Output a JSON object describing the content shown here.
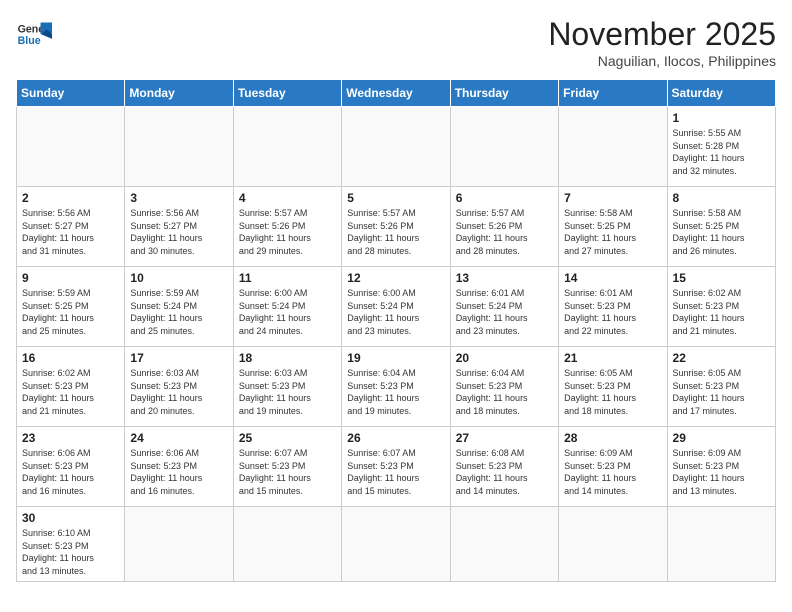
{
  "header": {
    "logo_general": "General",
    "logo_blue": "Blue",
    "title": "November 2025",
    "subtitle": "Naguilian, Ilocos, Philippines"
  },
  "weekdays": [
    "Sunday",
    "Monday",
    "Tuesday",
    "Wednesday",
    "Thursday",
    "Friday",
    "Saturday"
  ],
  "weeks": [
    [
      {
        "day": "",
        "info": ""
      },
      {
        "day": "",
        "info": ""
      },
      {
        "day": "",
        "info": ""
      },
      {
        "day": "",
        "info": ""
      },
      {
        "day": "",
        "info": ""
      },
      {
        "day": "",
        "info": ""
      },
      {
        "day": "1",
        "info": "Sunrise: 5:55 AM\nSunset: 5:28 PM\nDaylight: 11 hours\nand 32 minutes."
      }
    ],
    [
      {
        "day": "2",
        "info": "Sunrise: 5:56 AM\nSunset: 5:27 PM\nDaylight: 11 hours\nand 31 minutes."
      },
      {
        "day": "3",
        "info": "Sunrise: 5:56 AM\nSunset: 5:27 PM\nDaylight: 11 hours\nand 30 minutes."
      },
      {
        "day": "4",
        "info": "Sunrise: 5:57 AM\nSunset: 5:26 PM\nDaylight: 11 hours\nand 29 minutes."
      },
      {
        "day": "5",
        "info": "Sunrise: 5:57 AM\nSunset: 5:26 PM\nDaylight: 11 hours\nand 28 minutes."
      },
      {
        "day": "6",
        "info": "Sunrise: 5:57 AM\nSunset: 5:26 PM\nDaylight: 11 hours\nand 28 minutes."
      },
      {
        "day": "7",
        "info": "Sunrise: 5:58 AM\nSunset: 5:25 PM\nDaylight: 11 hours\nand 27 minutes."
      },
      {
        "day": "8",
        "info": "Sunrise: 5:58 AM\nSunset: 5:25 PM\nDaylight: 11 hours\nand 26 minutes."
      }
    ],
    [
      {
        "day": "9",
        "info": "Sunrise: 5:59 AM\nSunset: 5:25 PM\nDaylight: 11 hours\nand 25 minutes."
      },
      {
        "day": "10",
        "info": "Sunrise: 5:59 AM\nSunset: 5:24 PM\nDaylight: 11 hours\nand 25 minutes."
      },
      {
        "day": "11",
        "info": "Sunrise: 6:00 AM\nSunset: 5:24 PM\nDaylight: 11 hours\nand 24 minutes."
      },
      {
        "day": "12",
        "info": "Sunrise: 6:00 AM\nSunset: 5:24 PM\nDaylight: 11 hours\nand 23 minutes."
      },
      {
        "day": "13",
        "info": "Sunrise: 6:01 AM\nSunset: 5:24 PM\nDaylight: 11 hours\nand 23 minutes."
      },
      {
        "day": "14",
        "info": "Sunrise: 6:01 AM\nSunset: 5:23 PM\nDaylight: 11 hours\nand 22 minutes."
      },
      {
        "day": "15",
        "info": "Sunrise: 6:02 AM\nSunset: 5:23 PM\nDaylight: 11 hours\nand 21 minutes."
      }
    ],
    [
      {
        "day": "16",
        "info": "Sunrise: 6:02 AM\nSunset: 5:23 PM\nDaylight: 11 hours\nand 21 minutes."
      },
      {
        "day": "17",
        "info": "Sunrise: 6:03 AM\nSunset: 5:23 PM\nDaylight: 11 hours\nand 20 minutes."
      },
      {
        "day": "18",
        "info": "Sunrise: 6:03 AM\nSunset: 5:23 PM\nDaylight: 11 hours\nand 19 minutes."
      },
      {
        "day": "19",
        "info": "Sunrise: 6:04 AM\nSunset: 5:23 PM\nDaylight: 11 hours\nand 19 minutes."
      },
      {
        "day": "20",
        "info": "Sunrise: 6:04 AM\nSunset: 5:23 PM\nDaylight: 11 hours\nand 18 minutes."
      },
      {
        "day": "21",
        "info": "Sunrise: 6:05 AM\nSunset: 5:23 PM\nDaylight: 11 hours\nand 18 minutes."
      },
      {
        "day": "22",
        "info": "Sunrise: 6:05 AM\nSunset: 5:23 PM\nDaylight: 11 hours\nand 17 minutes."
      }
    ],
    [
      {
        "day": "23",
        "info": "Sunrise: 6:06 AM\nSunset: 5:23 PM\nDaylight: 11 hours\nand 16 minutes."
      },
      {
        "day": "24",
        "info": "Sunrise: 6:06 AM\nSunset: 5:23 PM\nDaylight: 11 hours\nand 16 minutes."
      },
      {
        "day": "25",
        "info": "Sunrise: 6:07 AM\nSunset: 5:23 PM\nDaylight: 11 hours\nand 15 minutes."
      },
      {
        "day": "26",
        "info": "Sunrise: 6:07 AM\nSunset: 5:23 PM\nDaylight: 11 hours\nand 15 minutes."
      },
      {
        "day": "27",
        "info": "Sunrise: 6:08 AM\nSunset: 5:23 PM\nDaylight: 11 hours\nand 14 minutes."
      },
      {
        "day": "28",
        "info": "Sunrise: 6:09 AM\nSunset: 5:23 PM\nDaylight: 11 hours\nand 14 minutes."
      },
      {
        "day": "29",
        "info": "Sunrise: 6:09 AM\nSunset: 5:23 PM\nDaylight: 11 hours\nand 13 minutes."
      }
    ],
    [
      {
        "day": "30",
        "info": "Sunrise: 6:10 AM\nSunset: 5:23 PM\nDaylight: 11 hours\nand 13 minutes."
      },
      {
        "day": "",
        "info": ""
      },
      {
        "day": "",
        "info": ""
      },
      {
        "day": "",
        "info": ""
      },
      {
        "day": "",
        "info": ""
      },
      {
        "day": "",
        "info": ""
      },
      {
        "day": "",
        "info": ""
      }
    ]
  ]
}
